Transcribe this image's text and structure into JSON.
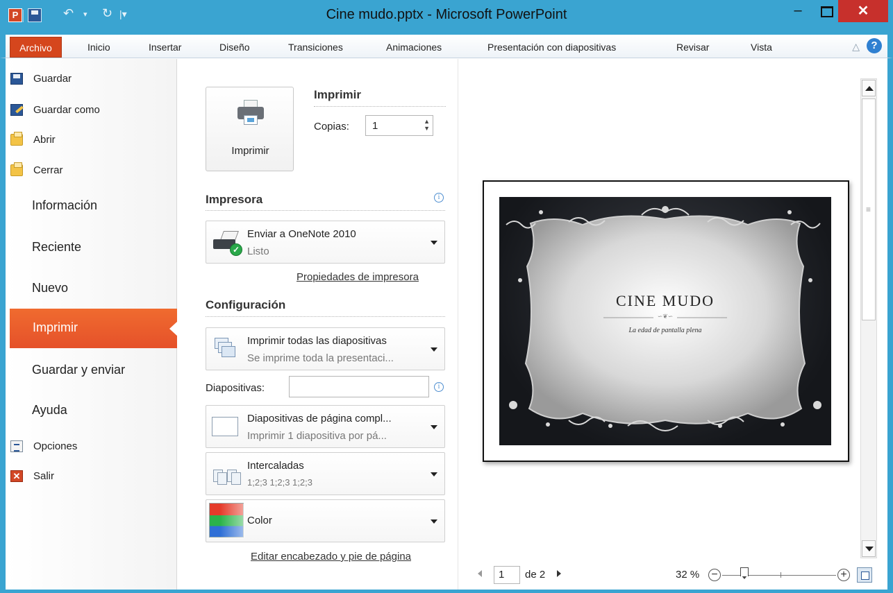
{
  "window": {
    "title": "Cine mudo.pptx - Microsoft PowerPoint",
    "app_icon_letter": "P",
    "minimize_glyph": "–",
    "close_glyph": "✕"
  },
  "qat": {
    "undo_glyph": "↶",
    "redo_glyph": "↻",
    "customize_glyph": "|▾"
  },
  "ribbon": {
    "file_tab": "Archivo",
    "tabs": [
      "Inicio",
      "Insertar",
      "Diseño",
      "Transiciones",
      "Animaciones",
      "Presentación con diapositivas",
      "Revisar",
      "Vista"
    ],
    "minimize_glyph": "△",
    "help_glyph": "?"
  },
  "backstage": {
    "items_small_top": [
      "Guardar",
      "Guardar como",
      "Abrir",
      "Cerrar"
    ],
    "items_big": [
      "Información",
      "Reciente",
      "Nuevo",
      "Imprimir",
      "Guardar y enviar",
      "Ayuda"
    ],
    "active_item": "Imprimir",
    "items_small_bottom": [
      "Opciones",
      "Salir"
    ]
  },
  "print": {
    "button_label": "Imprimir",
    "section_title": "Imprimir",
    "copies_label": "Copias:",
    "copies_value": "1",
    "printer_section": "Impresora",
    "printer_name": "Enviar a OneNote 2010",
    "printer_status": "Listo",
    "printer_properties_link": "Propiedades de impresora",
    "settings_section": "Configuración",
    "range_title": "Imprimir todas las diapositivas",
    "range_sub": "Se imprime toda la presentaci...",
    "slides_label": "Diapositivas:",
    "slides_value": "",
    "layout_title": "Diapositivas de página compl...",
    "layout_sub": "Imprimir 1 diapositiva por pá...",
    "collate_title": "Intercaladas",
    "collate_sub": "1;2;3   1;2;3   1;2;3",
    "color_title": "Color",
    "header_footer_link": "Editar encabezado y pie de página",
    "info_glyph": "i"
  },
  "preview": {
    "slide_title": "CINE MUDO",
    "slide_ornament": "∽❦∽",
    "slide_subtitle": "La edad de pantalla plena",
    "current_page": "1",
    "page_of": "de 2",
    "zoom": "32 %",
    "zoom_level_percent": 32,
    "zoom_minus_glyph": "−",
    "zoom_plus_glyph": "+"
  },
  "colors": {
    "titlebar": "#3aa4d1",
    "file_tab": "#d5461d",
    "active_backstage": "#ec5e2c",
    "close_button": "#c7302c"
  }
}
